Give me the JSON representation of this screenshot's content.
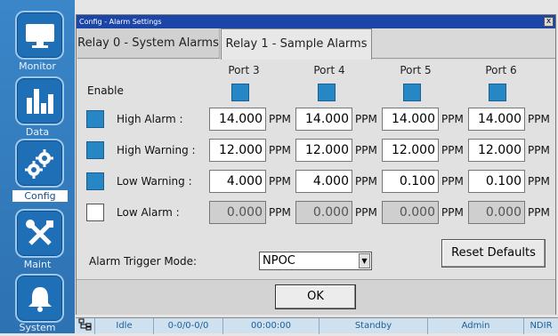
{
  "sidebar": {
    "items": [
      {
        "label": "Monitor",
        "icon": "monitor-icon"
      },
      {
        "label": "Data",
        "icon": "bar-chart-icon"
      },
      {
        "label": "Config",
        "icon": "gears-icon",
        "selected": true
      },
      {
        "label": "Maint",
        "icon": "tools-icon"
      },
      {
        "label": "System",
        "icon": "bell-icon"
      }
    ]
  },
  "window": {
    "title": "Config - Alarm Settings",
    "close": "x"
  },
  "tabs": [
    "Relay 0 - System Alarms",
    "Relay 1 - Sample Alarms"
  ],
  "ports": [
    "Port 3",
    "Port 4",
    "Port 5",
    "Port 6"
  ],
  "enable_label": "Enable",
  "unit": "PPM",
  "rows": [
    {
      "label": "High Alarm :",
      "checked": true,
      "values": [
        "14.000",
        "14.000",
        "14.000",
        "14.000"
      ],
      "editable": true
    },
    {
      "label": "High Warning :",
      "checked": true,
      "values": [
        "12.000",
        "12.000",
        "12.000",
        "12.000"
      ],
      "editable": true
    },
    {
      "label": "Low Warning :",
      "checked": true,
      "values": [
        "4.000",
        "4.000",
        "0.100",
        "0.100"
      ],
      "editable": true
    },
    {
      "label": "Low Alarm :",
      "checked": false,
      "values": [
        "0.000",
        "0.000",
        "0.000",
        "0.000"
      ],
      "editable": false
    }
  ],
  "trigger": {
    "label": "Alarm Trigger Mode:",
    "value": "NPOC"
  },
  "buttons": {
    "reset": "Reset Defaults",
    "ok": "OK"
  },
  "status": [
    "Idle",
    "0-0/0-0/0",
    "00:00:00",
    "Standby",
    "Admin",
    "NDIR"
  ],
  "colors": {
    "accent": "#2787c4",
    "sidebar": "#2d72b2",
    "titlebar": "#1c45a8"
  }
}
